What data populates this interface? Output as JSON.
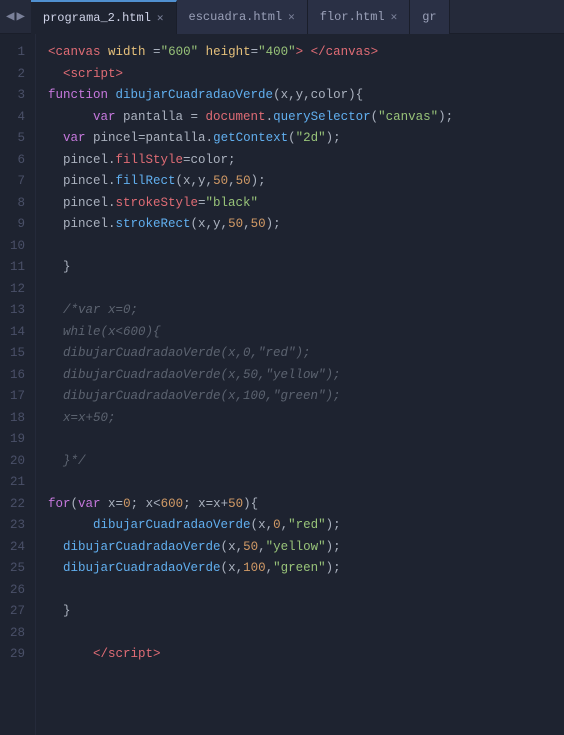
{
  "tabs": [
    {
      "id": "programa_2",
      "label": "programa_2.html",
      "active": true
    },
    {
      "id": "escuadra",
      "label": "escuadra.html",
      "active": false
    },
    {
      "id": "flor",
      "label": "flor.html",
      "active": false
    },
    {
      "id": "gr",
      "label": "gr",
      "active": false
    }
  ],
  "lines": [
    "1",
    "2",
    "3",
    "4",
    "5",
    "6",
    "7",
    "8",
    "9",
    "10",
    "11",
    "12",
    "13",
    "14",
    "15",
    "16",
    "17",
    "18",
    "19",
    "20",
    "21",
    "22",
    "23",
    "24",
    "25",
    "26",
    "27",
    "28",
    "29"
  ]
}
